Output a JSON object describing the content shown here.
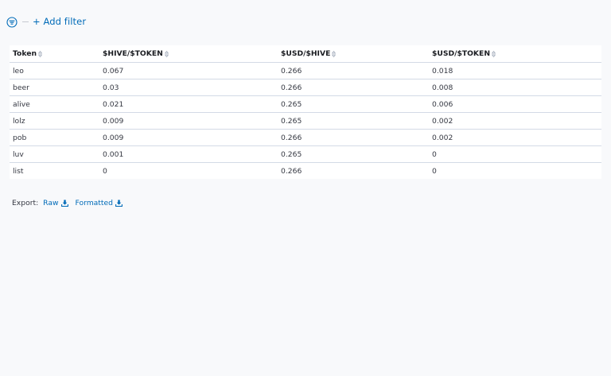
{
  "filter": {
    "add_filter_label": "+ Add filter"
  },
  "table": {
    "columns": [
      "Token",
      "$HIVE/$TOKEN",
      "$USD/$HIVE",
      "$USD/$TOKEN"
    ],
    "rows": [
      [
        "leo",
        "0.067",
        "0.266",
        "0.018"
      ],
      [
        "beer",
        "0.03",
        "0.266",
        "0.008"
      ],
      [
        "alive",
        "0.021",
        "0.265",
        "0.006"
      ],
      [
        "lolz",
        "0.009",
        "0.265",
        "0.002"
      ],
      [
        "pob",
        "0.009",
        "0.266",
        "0.002"
      ],
      [
        "luv",
        "0.001",
        "0.265",
        "0"
      ],
      [
        "list",
        "0",
        "0.266",
        "0"
      ]
    ]
  },
  "export": {
    "label": "Export:",
    "raw_label": "Raw",
    "formatted_label": "Formatted"
  },
  "colors": {
    "link": "#006bb8",
    "background": "#f8f9fb",
    "table_background": "#ffffff",
    "divider": "#d3dae6"
  },
  "icons": {
    "filter": "filter-icon",
    "sort": "sort-icon",
    "download": "download-icon"
  }
}
